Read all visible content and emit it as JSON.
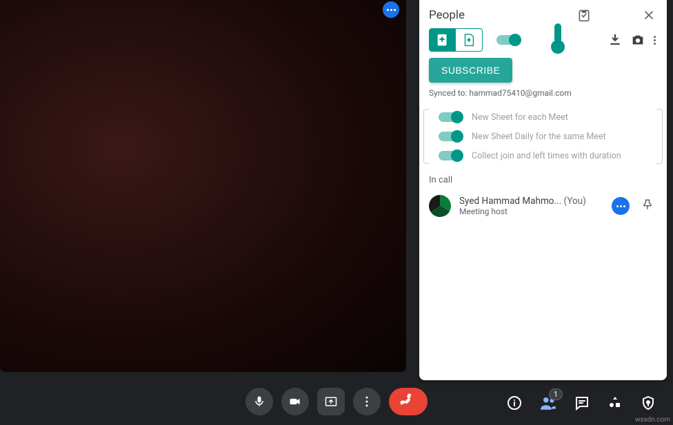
{
  "panel": {
    "title": "People",
    "subscribe_label": "SUBSCRIBE",
    "synced_text": "Synced to: hammad75410@gmail.com",
    "options": [
      {
        "label": "New Sheet for each Meet",
        "on": true
      },
      {
        "label": "New Sheet Daily for the same Meet",
        "on": true
      },
      {
        "label": "Collect join and left times with duration",
        "on": true
      }
    ],
    "in_call_label": "In call",
    "participants": [
      {
        "name": "Syed Hammad Mahmo...",
        "you_suffix": "(You)",
        "role": "Meeting host"
      }
    ]
  },
  "bottom": {
    "people_count": "1"
  },
  "watermark": "wsxdn.com"
}
